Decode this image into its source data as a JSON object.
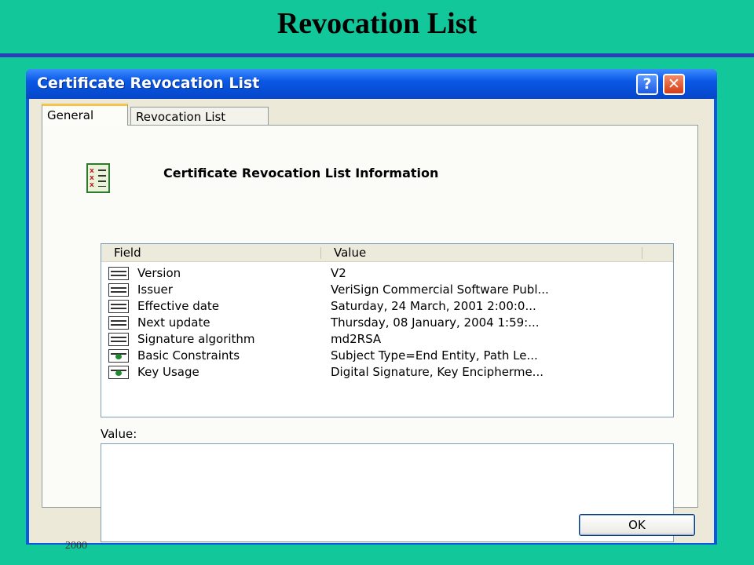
{
  "slide": {
    "title": "Revocation List",
    "footer_year": "2000"
  },
  "dialog": {
    "title": "Certificate Revocation List",
    "help_label": "?",
    "close_label": "✕",
    "tabs": [
      {
        "label": "General",
        "selected": true
      },
      {
        "label": "Revocation List",
        "selected": false
      }
    ],
    "info_title": "Certificate Revocation List Information",
    "columns": {
      "field": "Field",
      "value": "Value"
    },
    "rows": [
      {
        "field": "Version",
        "value": "V2",
        "icon": "property-icon"
      },
      {
        "field": "Issuer",
        "value": "VeriSign Commercial Software Publ...",
        "icon": "property-icon"
      },
      {
        "field": "Effective date",
        "value": "Saturday, 24 March, 2001 2:00:0...",
        "icon": "property-icon"
      },
      {
        "field": "Next update",
        "value": "Thursday, 08 January, 2004 1:59:...",
        "icon": "property-icon"
      },
      {
        "field": "Signature algorithm",
        "value": "md2RSA",
        "icon": "property-icon"
      },
      {
        "field": "Basic Constraints",
        "value": "Subject Type=End Entity, Path Le...",
        "icon": "extension-icon"
      },
      {
        "field": "Key Usage",
        "value": "Digital Signature, Key Encipherme...",
        "icon": "extension-icon"
      }
    ],
    "value_label": "Value:",
    "ok_label": "OK"
  },
  "colors": {
    "background": "#12c79a",
    "rule": "#2a3fb8",
    "titlebar": "#0a58e6"
  }
}
